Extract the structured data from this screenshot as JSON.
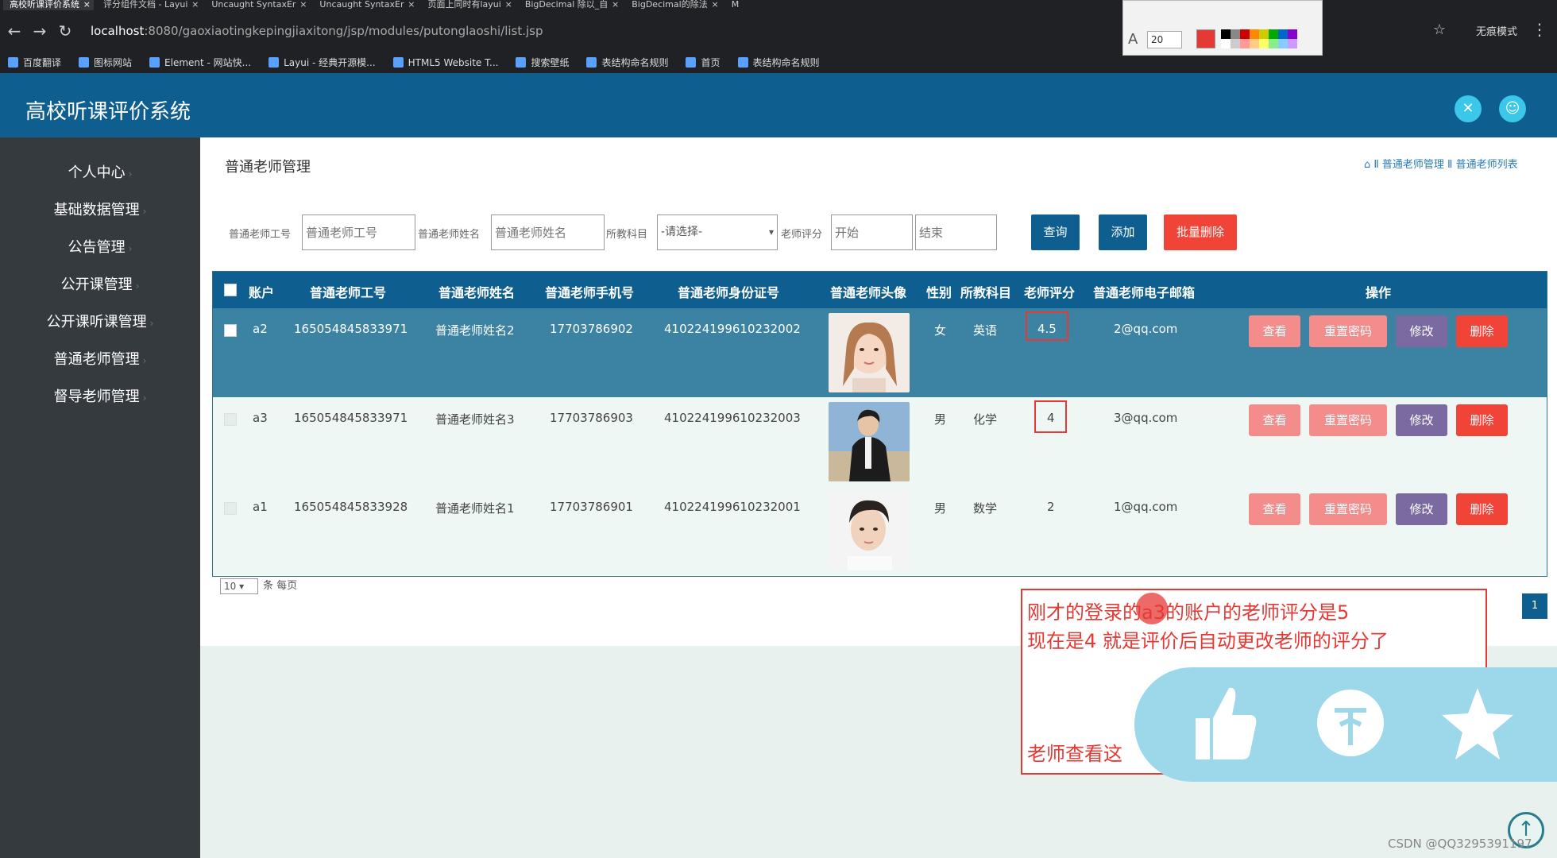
{
  "browser": {
    "tabs": [
      {
        "label": "高校听课评价系统"
      },
      {
        "label": "评分组件文档 - Layui"
      },
      {
        "label": "Uncaught SyntaxEr"
      },
      {
        "label": "Uncaught SyntaxEr"
      },
      {
        "label": "页面上同时有layui"
      },
      {
        "label": "BigDecimal 除以_自"
      },
      {
        "label": "BigDecimal的除法"
      },
      {
        "label": "M"
      }
    ],
    "url_host": "localhost",
    "url_rest": ":8080/gaoxiaotingkepingjiaxitong/jsp/modules/putonglaoshi/list.jsp",
    "incognito_label": "无痕模式",
    "bookmarks": [
      "百度翻译",
      "图标网站",
      "Element - 网站快...",
      "Layui - 经典开源模...",
      "HTML5 Website T...",
      "搜索壁纸",
      "表结构命名规则",
      "首页",
      "表结构命名规则"
    ],
    "toolbox": {
      "font_size": "20",
      "active_color": "#e53935"
    }
  },
  "app": {
    "title": "高校听课评价系统",
    "brand_color": "#0e5f8f"
  },
  "sidebar": {
    "items": [
      {
        "label": "个人中心"
      },
      {
        "label": "基础数据管理"
      },
      {
        "label": "公告管理"
      },
      {
        "label": "公开课管理"
      },
      {
        "label": "公开课听课管理"
      },
      {
        "label": "普通老师管理"
      },
      {
        "label": "督导老师管理"
      }
    ]
  },
  "page": {
    "title": "普通老师管理",
    "breadcrumb": "Ⅱ 普通老师管理 Ⅱ 普通老师列表"
  },
  "filters": {
    "id_label": "普通老师工号",
    "id_placeholder": "普通老师工号",
    "name_label": "普通老师姓名",
    "name_placeholder": "普通老师姓名",
    "subject_label": "所教科目",
    "subject_value": "-请选择-",
    "rating_label": "老师评分",
    "rating_start": "开始",
    "rating_end": "结束",
    "search_btn": "查询",
    "add_btn": "添加",
    "batch_delete_btn": "批量删除"
  },
  "table": {
    "headers": [
      "账户",
      "普通老师工号",
      "普通老师姓名",
      "普通老师手机号",
      "普通老师身份证号",
      "普通老师头像",
      "性别",
      "所教科目",
      "老师评分",
      "普通老师电子邮箱",
      "操作"
    ],
    "rows": [
      {
        "account": "a2",
        "id": "165054845833971",
        "name": "普通老师姓名2",
        "phone": "17703786902",
        "idcard": "410224199610232002",
        "gender": "女",
        "subject": "英语",
        "rating": "4.5",
        "email": "2@qq.com"
      },
      {
        "account": "a3",
        "id": "165054845833971",
        "name": "普通老师姓名3",
        "phone": "17703786903",
        "idcard": "410224199610232003",
        "gender": "男",
        "subject": "化学",
        "rating": "4",
        "email": "3@qq.com"
      },
      {
        "account": "a1",
        "id": "165054845833928",
        "name": "普通老师姓名1",
        "phone": "17703786901",
        "idcard": "410224199610232001",
        "gender": "男",
        "subject": "数学",
        "rating": "2",
        "email": "1@qq.com"
      }
    ],
    "actions": {
      "view": "查看",
      "reset": "重置密码",
      "edit": "修改",
      "delete": "删除"
    }
  },
  "pagination": {
    "per_page": "10",
    "per_page_suffix": "条 每页",
    "page": "1"
  },
  "annotation": {
    "line1": "刚才的登录的a3的账户的老师评分是5",
    "line2": "现在是4 就是评价后自动更改老师的评分了",
    "line3": "老师查看这"
  },
  "watermark": "CSDN @QQ3295391197"
}
